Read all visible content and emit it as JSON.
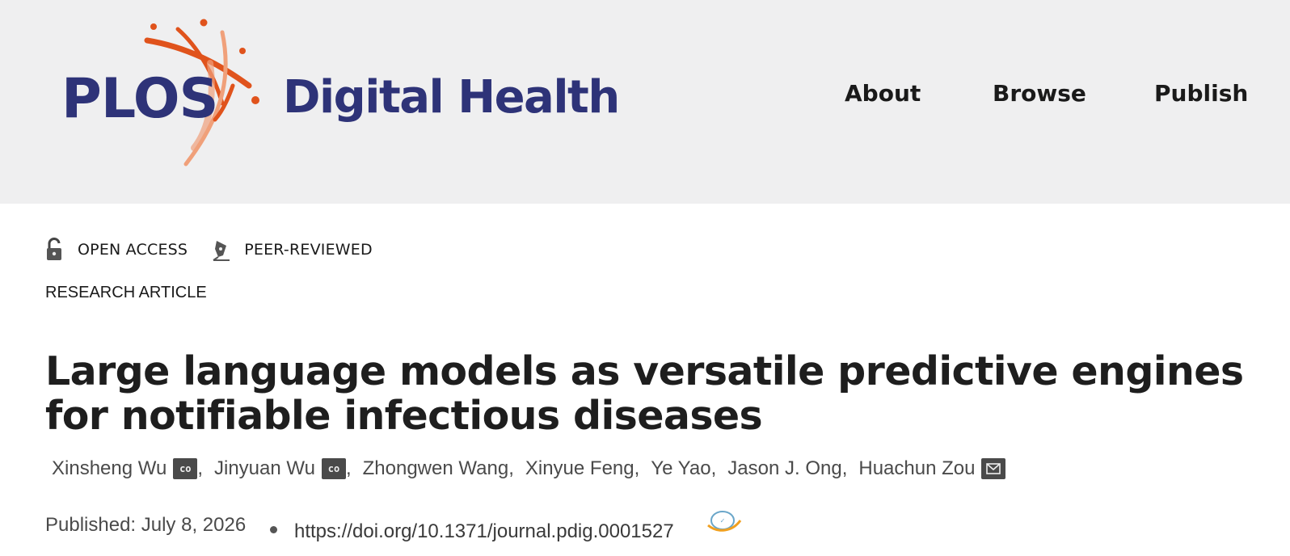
{
  "header": {
    "logo": {
      "wordmark_left": "PLOS",
      "wordmark_right": "Digital Health",
      "brand_color": "#2e3378",
      "accent_color": "#e0531c"
    },
    "nav": [
      {
        "label": "About"
      },
      {
        "label": "Browse"
      },
      {
        "label": "Publish"
      }
    ],
    "background": "#efeff0"
  },
  "badges": [
    {
      "icon": "open-lock-icon",
      "label": "OPEN ACCESS"
    },
    {
      "icon": "pen-nib-icon",
      "label": "PEER-REVIEWED"
    }
  ],
  "article": {
    "type": "RESEARCH ARTICLE",
    "title": "Large language models as versatile predictive engines for notifiable infectious diseases",
    "authors": [
      {
        "name": "Xinsheng Wu",
        "badge": "co",
        "badge_icon": "co-first-author-icon"
      },
      {
        "name": "Jinyuan Wu",
        "badge": "co",
        "badge_icon": "co-first-author-icon"
      },
      {
        "name": "Zhongwen Wang"
      },
      {
        "name": "Xinyue Feng"
      },
      {
        "name": "Ye Yao"
      },
      {
        "name": "Jason J. Ong"
      },
      {
        "name": "Huachun Zou",
        "badge_icon": "mail-icon"
      }
    ],
    "published": "Published: July 8, 2026",
    "doi": "https://doi.org/10.1371/journal.pdig.0001527"
  }
}
